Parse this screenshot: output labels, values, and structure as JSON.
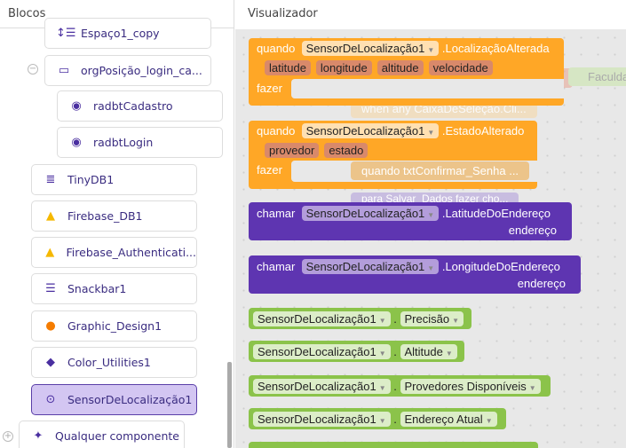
{
  "left_panel": {
    "title": "Blocos",
    "items": [
      {
        "label": "Espaço1_copy",
        "icon": "vertical-spacing-icon"
      },
      {
        "label": "orgPosição_login_ca...",
        "icon": "horizontal-arrangement-icon"
      },
      {
        "label": "radbtCadastro",
        "icon": "radio-button-icon"
      },
      {
        "label": "radbtLogin",
        "icon": "radio-button-icon"
      },
      {
        "label": "TinyDB1",
        "icon": "database-icon"
      },
      {
        "label": "Firebase_DB1",
        "icon": "firebase-icon"
      },
      {
        "label": "Firebase_Authenticati...",
        "icon": "firebase-icon"
      },
      {
        "label": "Snackbar1",
        "icon": "snackbar-icon"
      },
      {
        "label": "Graphic_Design1",
        "icon": "graphic-design-icon"
      },
      {
        "label": "Color_Utilities1",
        "icon": "paint-bucket-icon"
      },
      {
        "label": "SensorDeLocalização1",
        "icon": "location-sensor-icon",
        "selected": true
      },
      {
        "label": "Qualquer componente",
        "icon": "sparkle-icon"
      }
    ]
  },
  "workspace": {
    "title": "Visualizador",
    "ghosts": [
      "Faculdade",
      "when any CaixaDeSeleção.Cli...",
      "quando  txtConfirmar_Senha ...",
      "para Salvar_Dados fazer cho..."
    ],
    "events": [
      {
        "when": "quando",
        "component": "SensorDeLocalização1",
        "event": ".LocalizaçãoAlterada",
        "params": [
          "latitude",
          "longitude",
          "altitude",
          "velocidade"
        ],
        "do": "fazer"
      },
      {
        "when": "quando",
        "component": "SensorDeLocalização1",
        "event": ".EstadoAlterado",
        "params": [
          "provedor",
          "estado"
        ],
        "do": "fazer"
      }
    ],
    "calls": [
      {
        "call": "chamar",
        "component": "SensorDeLocalização1",
        "method": ".LatitudeDoEndereço",
        "arg": "endereço"
      },
      {
        "call": "chamar",
        "component": "SensorDeLocalização1",
        "method": ".LongitudeDoEndereço",
        "arg": "endereço"
      }
    ],
    "getters": [
      {
        "component": "SensorDeLocalização1",
        "property": "Precisão"
      },
      {
        "component": "SensorDeLocalização1",
        "property": "Altitude"
      },
      {
        "component": "SensorDeLocalização1",
        "property": "Provedores Disponíveis"
      },
      {
        "component": "SensorDeLocalização1",
        "property": "Endereço Atual"
      }
    ],
    "dot": "."
  },
  "colors": {
    "event": "#ffa726",
    "call": "#5e35b1",
    "getter": "#8bc34a",
    "selected": "#d3c6f2"
  }
}
